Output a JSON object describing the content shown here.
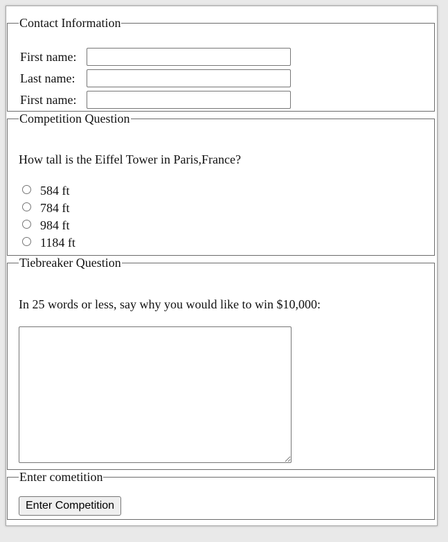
{
  "contact": {
    "legend": "Contact Information",
    "fields": [
      {
        "label": "First name:",
        "value": ""
      },
      {
        "label": "Last name:",
        "value": ""
      },
      {
        "label": "First name:",
        "value": ""
      }
    ]
  },
  "question": {
    "legend": "Competition Question",
    "text": "How tall is the Eiffel Tower in Paris,France?",
    "options": [
      "584 ft",
      "784 ft",
      "984 ft",
      "1184 ft"
    ],
    "selected": null
  },
  "tiebreaker": {
    "legend": "Tiebreaker Question",
    "text": "In 25 words or less, say why you would like to win $10,000:",
    "answer": ""
  },
  "enter": {
    "legend": "Enter cometition",
    "button_label": "Enter Competition"
  }
}
